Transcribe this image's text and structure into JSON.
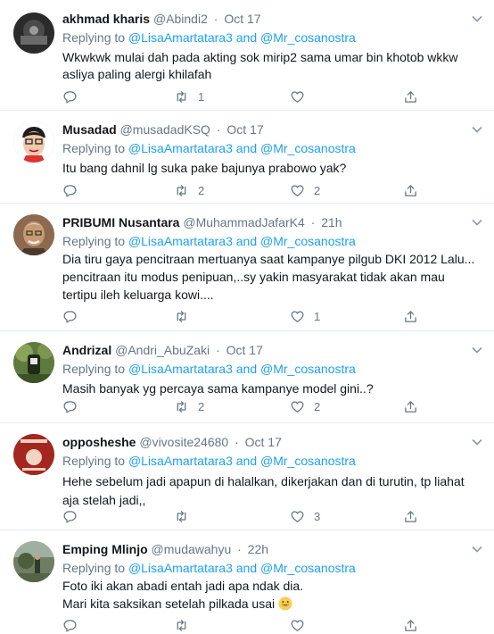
{
  "replying_to_label": "Replying to",
  "reply_mentions": [
    "@LisaAmartatara3",
    "@Mr_cosanostra"
  ],
  "reply_conjunction": "and",
  "colors": {
    "link": "#1da1f2",
    "muted": "#657786",
    "border": "#e6ecf0"
  },
  "tweets": [
    {
      "name": "akhmad kharis",
      "handle": "@Abindi2",
      "time": "Oct 17",
      "text": "Wkwkwk mulai dah pada akting sok mirip2 sama umar bin khotob wkkw asliya paling alergi khilafah",
      "reply_count": "",
      "retweet_count": "1",
      "like_count": "",
      "avatar_icon": "avatar-dark-photo"
    },
    {
      "name": "Musadad",
      "handle": "@musadadKSQ",
      "time": "Oct 17",
      "text": "Itu bang dahnil lg suka pake bajunya prabowo yak?",
      "reply_count": "",
      "retweet_count": "2",
      "like_count": "2",
      "avatar_icon": "avatar-cartoon-face"
    },
    {
      "name": "PRIBUMI Nusantara",
      "handle": "@MuhammadJafarK4",
      "time": "21h",
      "text": "Dia tiru gaya pencitraan mertuanya saat kampanye pilgub DKI 2012 Lalu... pencitraan itu modus penipuan,..sy yakin masyarakat tidak akan mau tertipu ileh keluarga  kowi....",
      "reply_count": "",
      "retweet_count": "",
      "like_count": "1",
      "avatar_icon": "avatar-man-photo"
    },
    {
      "name": "Andrizal",
      "handle": "@Andri_AbuZaki",
      "time": "Oct 17",
      "text": "Masih banyak yg percaya sama kampanye model gini..?",
      "reply_count": "",
      "retweet_count": "2",
      "like_count": "2",
      "avatar_icon": "avatar-green-photo"
    },
    {
      "name": "opposheshe",
      "handle": "@vivosite24680",
      "time": "Oct 17",
      "text": "Hehe sebelum jadi apapun di halalkan, dikerjakan dan di turutin, tp liahat aja stelah jadi,,",
      "reply_count": "",
      "retweet_count": "",
      "like_count": "3",
      "avatar_icon": "avatar-red-poster"
    },
    {
      "name": "Emping Mlinjo",
      "handle": "@mudawahyu",
      "time": "22h",
      "text": "Foto iki akan abadi entah jadi apa ndak dia.\nMari kita saksikan setelah pilkada usai",
      "reply_count": "",
      "retweet_count": "",
      "like_count": "",
      "avatar_icon": "avatar-outdoor-photo"
    }
  ]
}
